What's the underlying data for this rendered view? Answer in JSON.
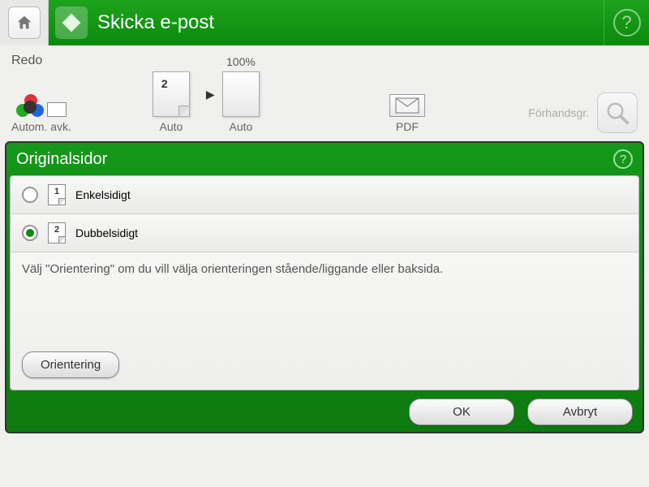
{
  "header": {
    "title": "Skicka e-post"
  },
  "status": "Redo",
  "options": {
    "color_label": "Autom. avk.",
    "src_label": "Auto",
    "src_page_number": "2",
    "zoom_percent": "100%",
    "dest_label": "Auto",
    "format_label": "PDF",
    "preview_label": "Förhandsgr."
  },
  "panel": {
    "title": "Originalsidor",
    "radios": [
      {
        "label": "Enkelsidigt",
        "page_number": "1",
        "checked": false
      },
      {
        "label": "Dubbelsidigt",
        "page_number": "2",
        "checked": true
      }
    ],
    "hint": "Välj \"Orientering\" om du vill välja orienteringen stående/liggande eller baksida.",
    "orientation_btn": "Orientering"
  },
  "footer": {
    "ok": "OK",
    "cancel": "Avbryt"
  }
}
